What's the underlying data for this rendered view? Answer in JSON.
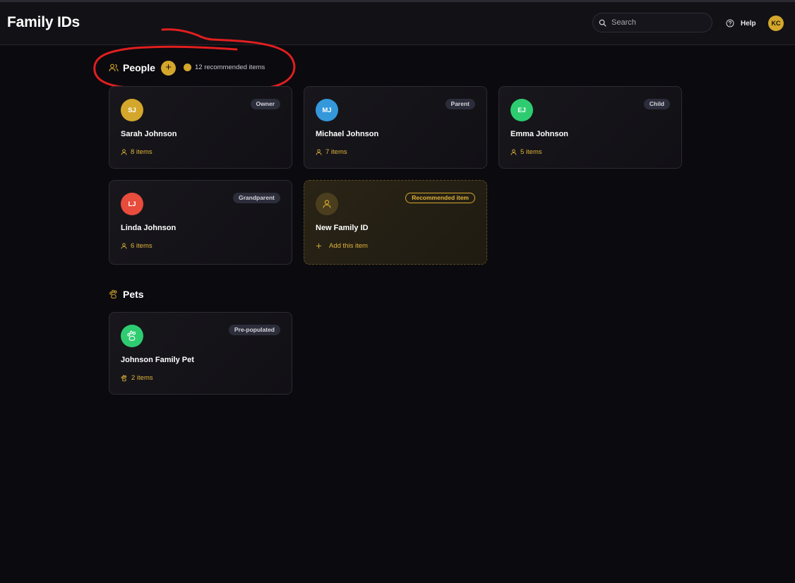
{
  "header": {
    "title": "Family IDs",
    "search_placeholder": "Search",
    "help_label": "Help",
    "user_initials": "KC"
  },
  "people": {
    "title": "People",
    "add_symbol": "+",
    "recommended_label": "12 recommended items",
    "cards": [
      {
        "initials": "SJ",
        "name": "Sarah Johnson",
        "badge": "Owner",
        "count": "8 items",
        "color": "#d4a72c"
      },
      {
        "initials": "MJ",
        "name": "Michael Johnson",
        "badge": "Parent",
        "count": "7 items",
        "color": "#3498db"
      },
      {
        "initials": "EJ",
        "name": "Emma Johnson",
        "badge": "Child",
        "count": "5 items",
        "color": "#2ecc71"
      },
      {
        "initials": "LJ",
        "name": "Linda Johnson",
        "badge": "Grandparent",
        "count": "6 items",
        "color": "#e74c3c"
      }
    ],
    "recommended_card": {
      "name": "New Family ID",
      "badge": "Recommended item",
      "action": "Add this item",
      "icon": "user-icon"
    }
  },
  "pets": {
    "title": "Pets",
    "cards": [
      {
        "name": "Johnson Family Pet",
        "badge": "Pre-populated",
        "count": "2 items",
        "color": "#2ecc71",
        "icon": "paw-icon"
      }
    ]
  },
  "colors": {
    "accent": "#d4a72c",
    "background": "#0b0a0f",
    "annotation": "#e01f1f"
  }
}
